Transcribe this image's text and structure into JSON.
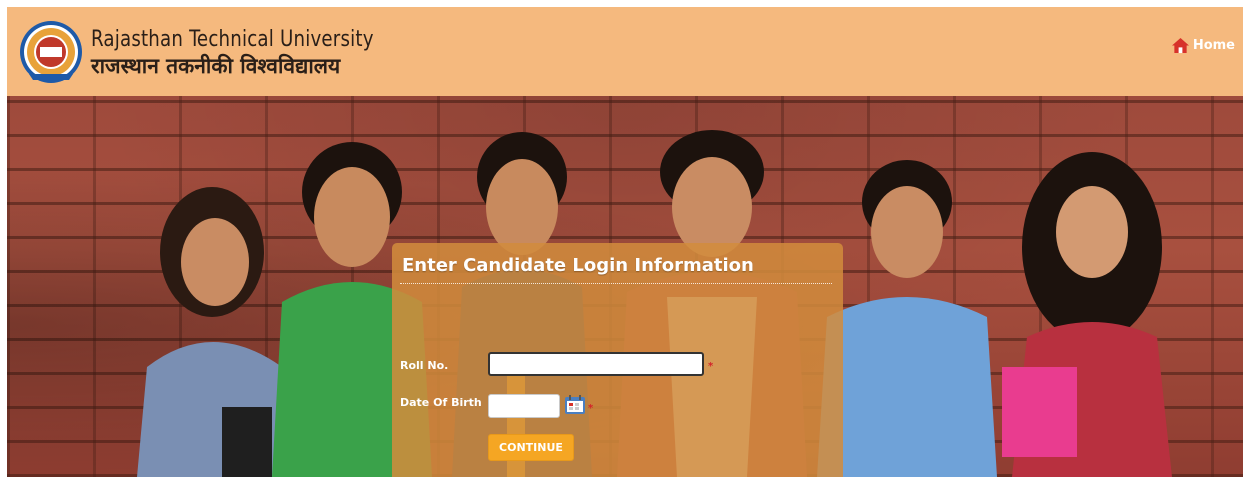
{
  "header": {
    "logo_icon": "university-seal-icon",
    "title_en": "Rajasthan Technical University",
    "title_hi": "राजस्थान तकनीकी विश्वविद्यालय",
    "home_label": "Home",
    "home_icon": "home-icon",
    "background_color": "#f5b97e"
  },
  "login": {
    "title": "Enter Candidate Login Information",
    "roll_label": "Roll No.",
    "roll_value": "",
    "dob_label": "Date Of Birth",
    "dob_value": "",
    "required_mark": "*",
    "calendar_icon": "calendar-icon",
    "continue_label": "CONTINUE",
    "panel_color": "#d28c3c",
    "button_color": "#f5a623"
  },
  "hero": {
    "image": "students-group-photo",
    "background": "brick-wall"
  }
}
